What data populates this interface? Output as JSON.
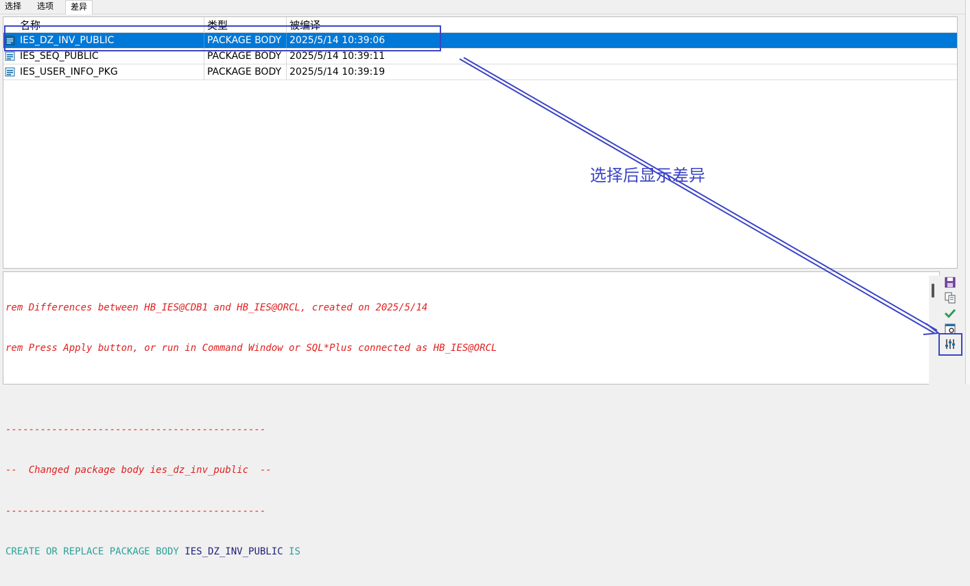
{
  "tabs": [
    "选择",
    "选项",
    "差异"
  ],
  "active_tab": "差异",
  "grid": {
    "columns": [
      "名称",
      "类型",
      "被编译"
    ],
    "rows": [
      {
        "name": "IES_DZ_INV_PUBLIC",
        "type": "PACKAGE BODY",
        "compiled": "2025/5/14 10:39:06",
        "selected": true
      },
      {
        "name": "IES_SEQ_PUBLIC",
        "type": "PACKAGE BODY",
        "compiled": "2025/5/14 10:39:11",
        "selected": false
      },
      {
        "name": "IES_USER_INFO_PKG",
        "type": "PACKAGE BODY",
        "compiled": "2025/5/14 10:39:19",
        "selected": false
      }
    ]
  },
  "script": {
    "line1": "rem Differences between HB_IES@CDB1 and HB_IES@ORCL, created on 2025/5/14",
    "line2": "rem Press Apply button, or run in Command Window or SQL*Plus connected as HB_IES@ORCL",
    "line3": "",
    "line4": "---------------------------------------------",
    "line5": "--  Changed package body ies_dz_inv_public  --",
    "line6": "---------------------------------------------",
    "line7_kw1": "CREATE OR REPLACE PACKAGE BODY ",
    "line7_id": "IES_DZ_INV_PUBLIC",
    "line7_kw2": " IS"
  },
  "toolbar": {
    "icons": [
      "save-icon",
      "copy-icon",
      "check-icon",
      "find-icon",
      "compare-settings-icon"
    ]
  },
  "annotation": {
    "text": "选择后显示差异",
    "color": "#3a43c6"
  },
  "colors": {
    "selection": "#0078d7",
    "comment": "#e02020",
    "keyword": "#2aa198",
    "identifier": "#20207a"
  }
}
